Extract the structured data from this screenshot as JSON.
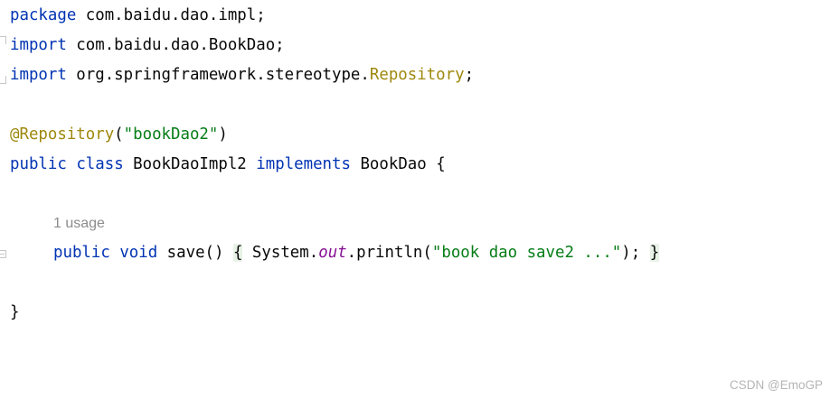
{
  "code": {
    "line_package": {
      "kw": "package",
      "rest": " com.baidu.dao.impl;"
    },
    "line_import1": {
      "kw": "import",
      "rest": " com.baidu.dao.BookDao;"
    },
    "line_import2": {
      "kw": "import",
      "pkg": " org.springframework.stereotype.",
      "cls": "Repository",
      "end": ";"
    },
    "line_annotation": {
      "ann": "@Repository",
      "open": "(",
      "str": "\"bookDao2\"",
      "close": ")"
    },
    "line_class": {
      "kw1": "public",
      "kw2": "class",
      "name": " BookDaoImpl2 ",
      "kw3": "implements",
      "iface": " BookDao {"
    },
    "usage_hint": "1 usage",
    "line_method": {
      "kw1": "public",
      "kw2": "void",
      "name": " save() ",
      "brace_open": "{",
      "call1": " System.",
      "field": "out",
      "call2": ".println(",
      "str": "\"book dao save2 ...\"",
      "call3": "); ",
      "brace_close": "}"
    },
    "line_close": "}"
  },
  "watermark": "CSDN @EmoGP",
  "colors": {
    "keyword": "#0033b3",
    "annotation": "#9e880d",
    "string": "#067d17",
    "static_field": "#871094",
    "text": "#080808",
    "hint": "#8c8c8c",
    "brace_highlight": "#e8f2e7"
  }
}
